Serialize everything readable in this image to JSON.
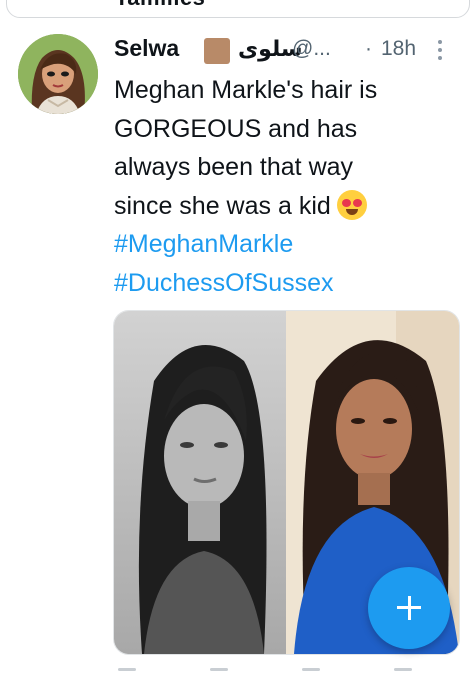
{
  "top_card": {
    "cut_text": "Tamilies"
  },
  "tweet": {
    "display_name": "Selwa",
    "arabic_name": "سلوى",
    "handle": "@...",
    "separator": "·",
    "time": "18h",
    "text_lines": [
      "Meghan Markle's hair is",
      "GORGEOUS and has",
      "always been that way",
      "since she was a kid"
    ],
    "hashtags": [
      "#MeghanMarkle",
      "#DuchessOfSussex"
    ]
  },
  "icons": {
    "skin_tone": "brown-square-emoji",
    "heart_eyes": "heart-eyes-emoji",
    "more": "more-vertical-icon",
    "compose": "plus-icon"
  },
  "colors": {
    "link": "#1d9bf0",
    "fab": "#1d9bf0",
    "muted": "#536471"
  }
}
